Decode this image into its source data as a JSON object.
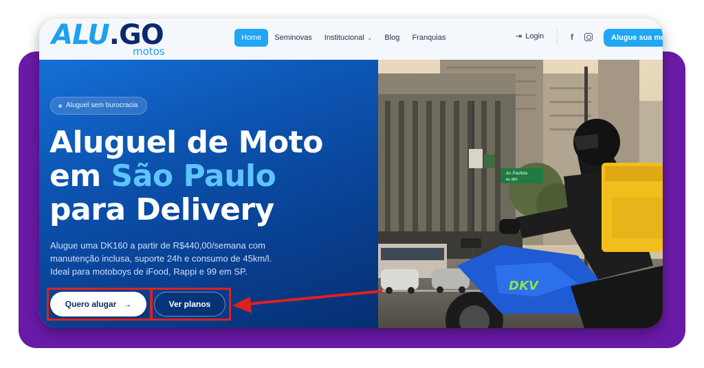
{
  "logo": {
    "brand_part1": "ALU",
    "brand_part2": "GO",
    "sub": "motos"
  },
  "nav": {
    "items": [
      {
        "label": "Home",
        "active": true
      },
      {
        "label": "Seminovas"
      },
      {
        "label": "Institucional",
        "has_dropdown": true
      },
      {
        "label": "Blog"
      },
      {
        "label": "Franquias"
      }
    ],
    "login": "Login",
    "cta": "Alugue sua moto"
  },
  "hero": {
    "badge": "Aluguel sem burocracia",
    "title_line1": "Aluguel de Moto",
    "title_line2_prefix": "em ",
    "title_line2_highlight": "São Paulo",
    "title_line3": "para Delivery",
    "description_line1": "Alugue uma DK160 a partir de R$440,00/semana com",
    "description_line2": "manutenção inclusa, suporte 24h e consumo de 45km/l.",
    "description_line3": "Ideal para motoboys de iFood, Rappi e 99 em SP.",
    "primary_button": "Quero alugar",
    "primary_button_icon": "→",
    "secondary_button": "Ver planos"
  },
  "photo": {
    "street_sign_line1": "Av. Paulista",
    "street_sign_line2": "Av. 850",
    "bike_brand": "DKV"
  },
  "colors": {
    "accent": "#1fa6f5",
    "brand_dark": "#0b2a6e",
    "hero_blue": "#0c53b0",
    "highlight": "#5ec4ff",
    "annotation_red": "#e0201f",
    "frame_purple": "#6a1aa8"
  }
}
